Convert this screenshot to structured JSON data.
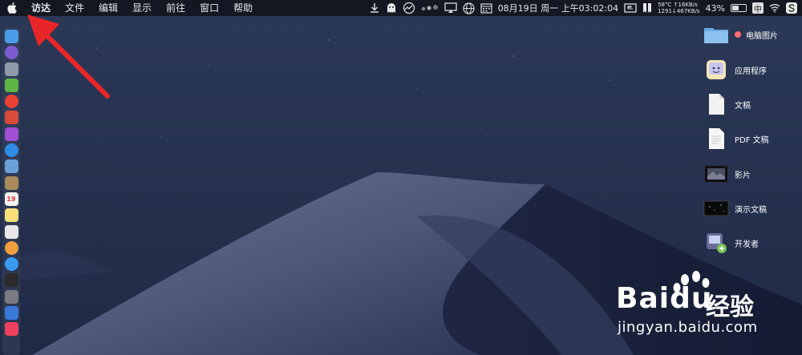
{
  "menubar": {
    "items": [
      "访达",
      "文件",
      "编辑",
      "显示",
      "前往",
      "窗口",
      "帮助"
    ],
    "status": {
      "date": "08月19日",
      "weekday": "周一",
      "time": "上午03:02:04",
      "temp": "58°C",
      "net_up": "↑16KB/s",
      "rpm": "1291",
      "net_down": "↓467KB/s",
      "battery": "43%",
      "battery_level": 0.43,
      "ime": "中"
    }
  },
  "stacks": [
    {
      "label": "电脑图片",
      "icon": "folder-icon",
      "tag_color": "#ff6b6b"
    },
    {
      "label": "应用程序",
      "icon": "applications-stack-icon"
    },
    {
      "label": "文稿",
      "icon": "documents-stack-icon"
    },
    {
      "label": "PDF 文稿",
      "icon": "pdf-documents-stack-icon"
    },
    {
      "label": "影片",
      "icon": "movies-stack-icon"
    },
    {
      "label": "演示文稿",
      "icon": "presentations-stack-icon"
    },
    {
      "label": "开发者",
      "icon": "developer-stack-icon"
    }
  ],
  "dock": {
    "apps": [
      {
        "name": "finder-icon",
        "color": "#4a9ce8"
      },
      {
        "name": "siri-icon",
        "color": "#7a5cd0"
      },
      {
        "name": "launchpad-icon",
        "color": "#8e9aa8"
      },
      {
        "name": "android-icon",
        "color": "#5fb544"
      },
      {
        "name": "chrome-icon",
        "color": "#e94235"
      },
      {
        "name": "app-red-icon",
        "color": "#d84a3a"
      },
      {
        "name": "app-purple-icon",
        "color": "#a04fd0"
      },
      {
        "name": "safari-icon",
        "color": "#2f8de4"
      },
      {
        "name": "preview-icon",
        "color": "#6aa2d8"
      },
      {
        "name": "notebook-icon",
        "color": "#a88a5a"
      },
      {
        "name": "calendar-icon",
        "color": "#f2f2f2"
      },
      {
        "name": "notes-icon",
        "color": "#f5e07a"
      },
      {
        "name": "textedit-icon",
        "color": "#e8e8e8"
      },
      {
        "name": "photos-icon",
        "color": "#f0a040"
      },
      {
        "name": "messages-icon",
        "color": "#3a9af0"
      },
      {
        "name": "app-dark-icon",
        "color": "#2a2a2a"
      },
      {
        "name": "system-preferences-icon",
        "color": "#7a7a80"
      },
      {
        "name": "keynote-icon",
        "color": "#3a78d8"
      },
      {
        "name": "music-icon",
        "color": "#f04060"
      }
    ],
    "calendar_day": "19"
  },
  "watermark": {
    "brand": "Bai",
    "brand_tail": "du",
    "cn": "经验",
    "url": "jingyan.baidu.com"
  },
  "colors": {
    "menubar_bg": "#14161e",
    "arrow": "#e8262a"
  }
}
